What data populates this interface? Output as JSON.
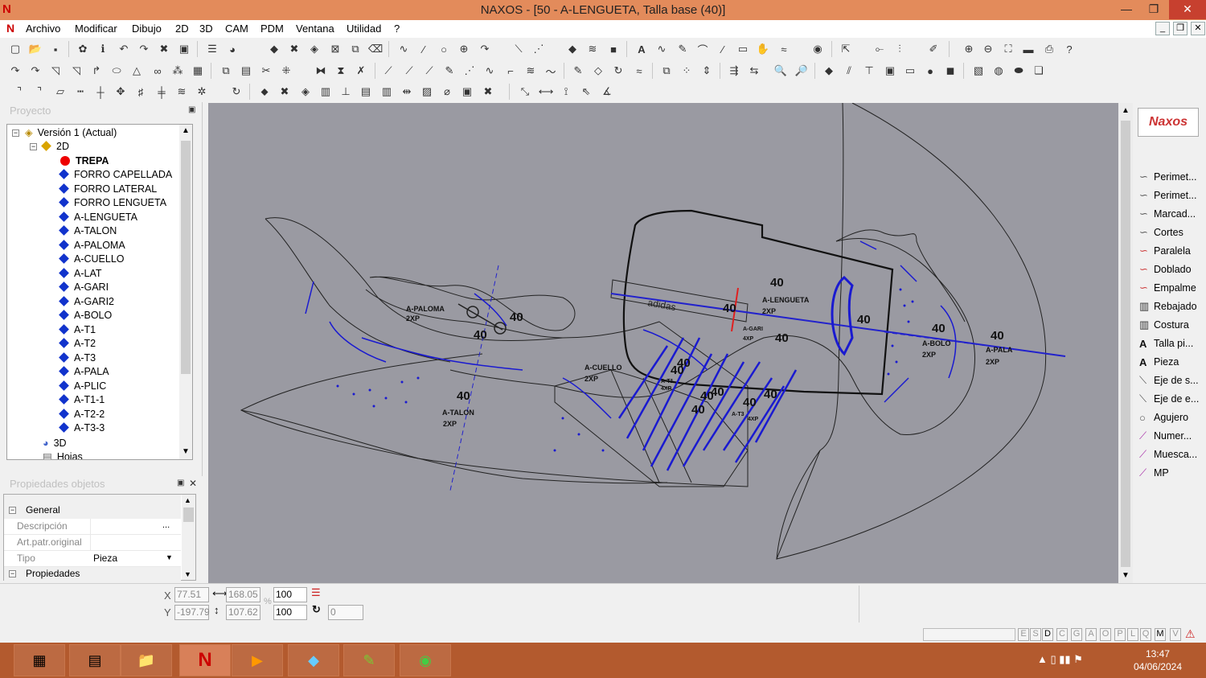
{
  "window": {
    "title": "NAXOS - [50 - A-LENGUETA, Talla base (40)]",
    "logo": "N",
    "min": "—",
    "max": "❐",
    "close": "✕"
  },
  "menu": {
    "items": [
      "Archivo",
      "Modificar",
      "Dibujo",
      "2D",
      "3D",
      "CAM",
      "PDM",
      "Ventana",
      "Utilidad",
      "?"
    ],
    "mdi_buttons": [
      "_",
      "❐",
      "✕"
    ]
  },
  "project_panel": {
    "title": "Proyecto",
    "root": "Versión 1 (Actual)",
    "group_2d": "2D",
    "selected_item": "TREPA",
    "pieces": [
      "FORRO CAPELLADA",
      "FORRO LATERAL",
      "FORRO LENGUETA",
      "A-LENGUETA",
      "A-TALON",
      "A-PALOMA",
      "A-CUELLO",
      "A-LAT",
      "A-GARI",
      "A-GARI2",
      "A-BOLO",
      "A-T1",
      "A-T2",
      "A-T3",
      "A-PALA",
      "A-PLIC",
      "A-T1-1",
      "A-T2-2",
      "A-T3-3"
    ],
    "group_3d": "3D",
    "group_hojas": "Hojas"
  },
  "properties_panel": {
    "title": "Propiedades objetos",
    "section_general": "General",
    "descripcion_label": "Descripción",
    "artpatr_label": "Art.patr.original",
    "tipo_label": "Tipo",
    "tipo_value": "Pieza",
    "section_propiedades": "Propiedades",
    "ellipsis": "..."
  },
  "right_panel": {
    "logo": "Naxos",
    "tools": [
      {
        "label": "Perimet...",
        "icon": "curve-icon"
      },
      {
        "label": "Perimet...",
        "icon": "curve-icon"
      },
      {
        "label": "Marcad...",
        "icon": "curve-icon"
      },
      {
        "label": "Cortes",
        "icon": "curve-icon"
      },
      {
        "label": "Paralela",
        "icon": "curve-icon"
      },
      {
        "label": "Doblado",
        "icon": "curve-icon"
      },
      {
        "label": "Empalme",
        "icon": "curve-icon"
      },
      {
        "label": "Rebajado",
        "icon": "stitch-icon"
      },
      {
        "label": "Costura",
        "icon": "stitch-icon"
      },
      {
        "label": "Talla pi...",
        "icon": "text-icon"
      },
      {
        "label": "Pieza",
        "icon": "text-icon"
      },
      {
        "label": "Eje de s...",
        "icon": "axis-icon"
      },
      {
        "label": "Eje de e...",
        "icon": "axis-icon"
      },
      {
        "label": "Agujero",
        "icon": "circle-icon"
      },
      {
        "label": "Numer...",
        "icon": "line-icon"
      },
      {
        "label": "Muesca...",
        "icon": "line-icon"
      },
      {
        "label": "MP",
        "icon": "line-icon"
      }
    ]
  },
  "canvas": {
    "labels": {
      "paloma": "A-PALOMA",
      "paloma_qty": "2XP",
      "talon": "A-TALON",
      "talon_qty": "2XP",
      "cuello": "A-CUELLO",
      "cuello_qty": "2XP",
      "lengueta": "A-LENGUETA",
      "lengueta_qty": "2XP",
      "gari": "A-GARI",
      "gari_qty": "4XP",
      "bolo": "A-BOLO",
      "bolo_qty": "2XP",
      "pala": "A-PALA",
      "pala_qty": "2XP",
      "t1": "A-T1",
      "t1_qty": "4XP",
      "t3": "A-T3",
      "t3_qty": "4XP",
      "size": "40",
      "logo_text": "adidas",
      "size_label_count": 17
    }
  },
  "coords": {
    "x_label": "X",
    "y_label": "Y",
    "x_value": "77.51",
    "y_value": "-197.79",
    "width_value": "168.05",
    "height_value": "107.62",
    "scale_x": "100",
    "scale_y": "100",
    "rotation": "0",
    "percent": "%"
  },
  "status": {
    "letters": [
      "E",
      "S",
      "D",
      "C",
      "G",
      "A",
      "O",
      "P",
      "L",
      "Q",
      "M",
      "V"
    ]
  },
  "taskbar": {
    "apps": [
      {
        "name": "calculator-icon",
        "glyph": "▦"
      },
      {
        "name": "explorer-icon",
        "glyph": "▤"
      },
      {
        "name": "folder-icon",
        "glyph": "📁"
      },
      {
        "name": "naxos-icon",
        "glyph": "N"
      },
      {
        "name": "media-icon",
        "glyph": "▶"
      },
      {
        "name": "document-icon",
        "glyph": "◆"
      },
      {
        "name": "cad-icon",
        "glyph": "✎"
      },
      {
        "name": "chrome-icon",
        "glyph": "◉"
      }
    ],
    "time": "13:47",
    "date": "04/06/2024",
    "tray": "▲  ▯  ▮▮  ⚑"
  }
}
